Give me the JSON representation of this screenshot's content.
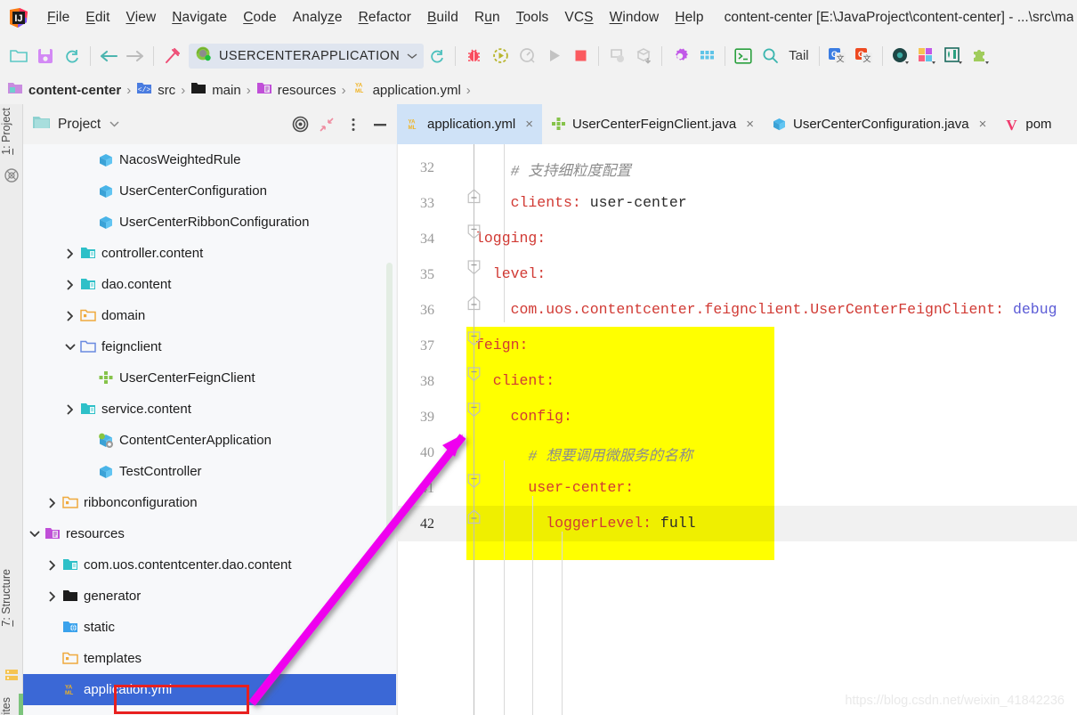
{
  "window": {
    "title": "content-center [E:\\JavaProject\\content-center] - ...\\src\\ma"
  },
  "menubar": {
    "items": [
      {
        "label": "File",
        "mnemonic": "F"
      },
      {
        "label": "Edit",
        "mnemonic": "E"
      },
      {
        "label": "View",
        "mnemonic": "V"
      },
      {
        "label": "Navigate",
        "mnemonic": "N"
      },
      {
        "label": "Code",
        "mnemonic": "C"
      },
      {
        "label": "Analyze",
        "mnemonic": "z"
      },
      {
        "label": "Refactor",
        "mnemonic": "R"
      },
      {
        "label": "Build",
        "mnemonic": "B"
      },
      {
        "label": "Run",
        "mnemonic": "u"
      },
      {
        "label": "Tools",
        "mnemonic": "T"
      },
      {
        "label": "VCS",
        "mnemonic": "S"
      },
      {
        "label": "Window",
        "mnemonic": "W"
      },
      {
        "label": "Help",
        "mnemonic": "H"
      }
    ]
  },
  "toolbar": {
    "run_configuration": "USERCENTERAPPLICATION",
    "tail_label": "Tail",
    "icons": [
      "open-folder-icon",
      "save-all-icon",
      "sync-icon",
      "back-arrow-icon",
      "forward-arrow-icon",
      "build-hammer-icon"
    ],
    "right_icons": [
      "rerun-icon",
      "debug-bug-icon",
      "run-with-coverage-icon",
      "profiler-icon",
      "run-icon",
      "stop-icon",
      "update-app-icon",
      "package-download-icon",
      "settings-gear-icon",
      "grid-apps-icon",
      "terminal-icon",
      "search-icon",
      "translate-blue-icon",
      "translate-red-icon",
      "record-icon",
      "layout-blocks-icon",
      "database-icon",
      "plugin-puzzle-icon"
    ]
  },
  "breadcrumb": {
    "separator": "›",
    "items": [
      {
        "label": "content-center",
        "icon": "module-folder-icon",
        "bold": true
      },
      {
        "label": "src",
        "icon": "source-root-icon",
        "bold": false
      },
      {
        "label": "main",
        "icon": "folder-dark-icon",
        "bold": false
      },
      {
        "label": "resources",
        "icon": "resources-root-icon",
        "bold": false
      },
      {
        "label": "application.yml",
        "icon": "yaml-file-icon",
        "bold": false
      }
    ]
  },
  "tool_window_strip": {
    "tabs": [
      {
        "label": "1: Project",
        "mnemonic": "1"
      },
      {
        "label": "7: Structure",
        "mnemonic": "7"
      },
      {
        "label": "rites",
        "mnemonic": ""
      }
    ]
  },
  "project_panel": {
    "title": "Project",
    "dropdown_caret": "⌄",
    "header_icons": [
      "target-scope-icon",
      "collapse-all-icon",
      "options-menu-icon",
      "hide-icon"
    ],
    "tree": [
      {
        "label": "NacosWeightedRule",
        "icon": "java-class-icon",
        "indent": 4,
        "arrow": "none",
        "selected": false
      },
      {
        "label": "UserCenterConfiguration",
        "icon": "java-class-icon",
        "indent": 4,
        "arrow": "none",
        "selected": false
      },
      {
        "label": "UserCenterRibbonConfiguration",
        "icon": "java-class-icon",
        "indent": 4,
        "arrow": "none",
        "selected": false
      },
      {
        "label": "controller.content",
        "icon": "package-icon",
        "indent": 3,
        "arrow": "collapsed",
        "selected": false
      },
      {
        "label": "dao.content",
        "icon": "package-icon",
        "indent": 3,
        "arrow": "collapsed",
        "selected": false
      },
      {
        "label": "domain",
        "icon": "folder-yellow-icon",
        "indent": 3,
        "arrow": "collapsed",
        "selected": false
      },
      {
        "label": "feignclient",
        "icon": "folder-blue-icon",
        "indent": 3,
        "arrow": "expanded",
        "selected": false
      },
      {
        "label": "UserCenterFeignClient",
        "icon": "interface-green-icon",
        "indent": 4,
        "arrow": "none",
        "selected": false
      },
      {
        "label": "service.content",
        "icon": "package-icon",
        "indent": 3,
        "arrow": "collapsed",
        "selected": false
      },
      {
        "label": "ContentCenterApplication",
        "icon": "spring-boot-icon",
        "indent": 4,
        "arrow": "none",
        "selected": false
      },
      {
        "label": "TestController",
        "icon": "java-class-icon",
        "indent": 4,
        "arrow": "none",
        "selected": false
      },
      {
        "label": "ribbonconfiguration",
        "icon": "folder-yellow-icon",
        "indent": 2,
        "arrow": "collapsed",
        "selected": false
      },
      {
        "label": "resources",
        "icon": "resources-root-icon",
        "indent": 1,
        "arrow": "expanded",
        "selected": false
      },
      {
        "label": "com.uos.contentcenter.dao.content",
        "icon": "package-icon",
        "indent": 2,
        "arrow": "collapsed",
        "selected": false
      },
      {
        "label": "generator",
        "icon": "folder-dark-icon",
        "indent": 2,
        "arrow": "collapsed",
        "selected": false
      },
      {
        "label": "static",
        "icon": "web-folder-icon",
        "indent": 2,
        "arrow": "none",
        "selected": false
      },
      {
        "label": "templates",
        "icon": "folder-yellow-icon",
        "indent": 2,
        "arrow": "none",
        "selected": false
      },
      {
        "label": "application.yml",
        "icon": "yaml-file-icon",
        "indent": 2,
        "arrow": "none",
        "selected": true
      }
    ]
  },
  "editor": {
    "tabs": [
      {
        "label": "application.yml",
        "icon": "yaml-file-icon",
        "active": true,
        "close": "×"
      },
      {
        "label": "UserCenterFeignClient.java",
        "icon": "interface-green-icon",
        "active": false,
        "close": "×"
      },
      {
        "label": "UserCenterConfiguration.java",
        "icon": "java-class-icon",
        "active": false,
        "close": "×"
      },
      {
        "label": "pom",
        "icon": "maven-v-icon",
        "active": false,
        "close": ""
      }
    ],
    "current_line": 42,
    "lines": [
      {
        "num": "32",
        "indent": 4,
        "fold": "none",
        "highlight": false,
        "tokens": [
          {
            "t": "# 支持细粒度配置",
            "c": "cmt"
          }
        ]
      },
      {
        "num": "33",
        "indent": 4,
        "fold": "end",
        "highlight": false,
        "tokens": [
          {
            "t": "clients:",
            "c": "key"
          },
          {
            "t": " user-center",
            "c": "val"
          }
        ]
      },
      {
        "num": "34",
        "indent": 0,
        "fold": "start",
        "highlight": false,
        "tokens": [
          {
            "t": "logging:",
            "c": "key"
          }
        ]
      },
      {
        "num": "35",
        "indent": 2,
        "fold": "start",
        "highlight": false,
        "tokens": [
          {
            "t": "level:",
            "c": "key"
          }
        ]
      },
      {
        "num": "36",
        "indent": 4,
        "fold": "end",
        "highlight": false,
        "tokens": [
          {
            "t": "com.uos.contentcenter.feignclient.UserCenterFeignClient:",
            "c": "key"
          },
          {
            "t": " debug",
            "c": "num"
          }
        ]
      },
      {
        "num": "37",
        "indent": 0,
        "fold": "start",
        "highlight": true,
        "tokens": [
          {
            "t": "feign:",
            "c": "key"
          }
        ]
      },
      {
        "num": "38",
        "indent": 2,
        "fold": "start",
        "highlight": true,
        "tokens": [
          {
            "t": "client:",
            "c": "key"
          }
        ]
      },
      {
        "num": "39",
        "indent": 4,
        "fold": "start",
        "highlight": true,
        "tokens": [
          {
            "t": "config:",
            "c": "key"
          }
        ]
      },
      {
        "num": "40",
        "indent": 6,
        "fold": "none",
        "highlight": true,
        "tokens": [
          {
            "t": "# 想要调用微服务的名称",
            "c": "cmt"
          }
        ]
      },
      {
        "num": "41",
        "indent": 6,
        "fold": "start",
        "highlight": true,
        "tokens": [
          {
            "t": "user-center:",
            "c": "key"
          }
        ]
      },
      {
        "num": "42",
        "indent": 8,
        "fold": "end",
        "highlight": true,
        "tokens": [
          {
            "t": "loggerLevel:",
            "c": "key"
          },
          {
            "t": " full",
            "c": "val"
          }
        ]
      }
    ]
  },
  "annotation": {
    "arrow_color": "#ef00ef",
    "highlight_color": "#ffff00",
    "selection_box_color": "#e8201f"
  },
  "watermark": {
    "text": "https://blog.csdn.net/weixin_41842236"
  }
}
